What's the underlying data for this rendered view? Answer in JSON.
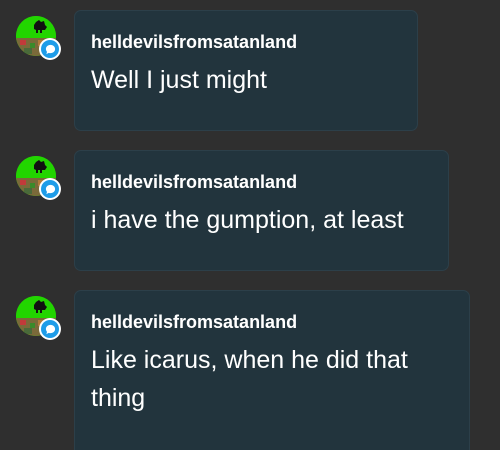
{
  "messages": [
    {
      "username": "helldevilsfromsatanland",
      "text": "Well I just might"
    },
    {
      "username": "helldevilsfromsatanland",
      "text": "i have the gumption, at least"
    },
    {
      "username": "helldevilsfromsatanland",
      "text": "Like icarus, when he did that thing"
    }
  ],
  "icons": {
    "avatar": "user-avatar",
    "badge": "chat-bubble-icon"
  },
  "colors": {
    "background": "#2f2f2f",
    "bubble": "#22343d",
    "avatar_green": "#22d500",
    "badge_blue": "#1e9ce8",
    "text": "#ffffff"
  }
}
